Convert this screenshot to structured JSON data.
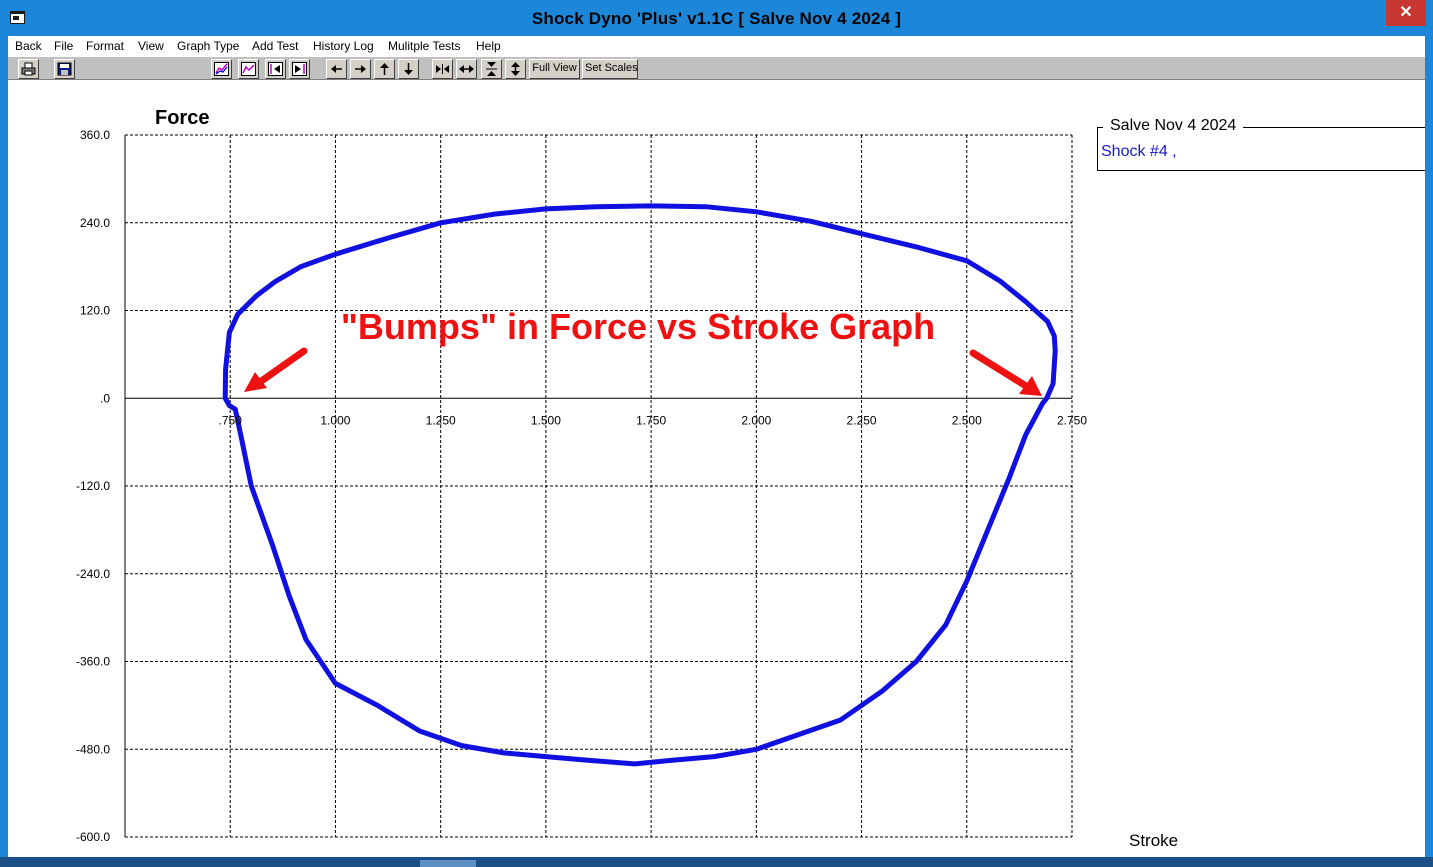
{
  "window": {
    "title": "Shock Dyno 'Plus' v1.1C  [ Salve Nov 4 2024 ]",
    "close_glyph": "✕",
    "app_icon": "app-window-icon"
  },
  "menu": {
    "items": [
      "Back",
      "File",
      "Format",
      "View",
      "Graph Type",
      "Add Test",
      "History Log",
      "Mulitple Tests",
      "Help"
    ]
  },
  "toolbar": {
    "buttons": [
      {
        "icon": "print-icon"
      },
      {
        "icon": "save-icon"
      },
      {
        "icon": "graph-overlay-icon"
      },
      {
        "icon": "graph-icon"
      },
      {
        "icon": "previous-test-icon"
      },
      {
        "icon": "next-test-icon"
      },
      {
        "icon": "arrow-left-icon"
      },
      {
        "icon": "arrow-right-icon"
      },
      {
        "icon": "arrow-up-icon"
      },
      {
        "icon": "arrow-down-icon"
      },
      {
        "icon": "shrink-horizontal-icon"
      },
      {
        "icon": "expand-horizontal-icon"
      },
      {
        "icon": "shrink-vertical-icon"
      },
      {
        "icon": "expand-vertical-icon"
      }
    ],
    "full_view_label": "Full View",
    "set_scales_label": "Set Scales"
  },
  "chart_data": {
    "type": "line",
    "title": "",
    "ylabel": "Force",
    "xlabel": "Stroke",
    "xlim": [
      0.5,
      2.75
    ],
    "ylim": [
      -600,
      360
    ],
    "x_ticks": [
      0.75,
      1.0,
      1.25,
      1.5,
      1.75,
      2.0,
      2.25,
      2.5,
      2.75
    ],
    "x_tick_labels": [
      ".750",
      "1.000",
      "1.250",
      "1.500",
      "1.750",
      "2.000",
      "2.250",
      "2.500",
      "2.750"
    ],
    "y_ticks": [
      360,
      240,
      120,
      0,
      -120,
      -240,
      -360,
      -480,
      -600
    ],
    "y_tick_labels": [
      "360.0",
      "240.0",
      "120.0",
      ".0",
      "-120.0",
      "-240.0",
      "-360.0",
      "-480.0",
      "-600.0"
    ],
    "grid": true,
    "grid_style": "dotted",
    "line_color": "#1010e0",
    "series": [
      {
        "x": [
          0.738,
          0.739,
          0.748,
          0.768,
          0.812,
          0.858,
          0.918,
          1.0,
          1.13,
          1.25,
          1.38,
          1.5,
          1.62,
          1.75,
          1.88,
          2.0,
          2.13,
          2.25,
          2.38,
          2.5,
          2.58,
          2.64,
          2.692,
          2.708,
          2.71,
          2.705,
          2.69,
          2.68,
          2.64,
          2.6,
          2.55,
          2.5,
          2.45,
          2.38,
          2.3,
          2.2,
          2.1,
          2.0,
          1.9,
          1.8,
          1.71,
          1.6,
          1.5,
          1.4,
          1.3,
          1.2,
          1.1,
          1.0,
          0.93,
          0.89,
          0.85,
          0.8,
          0.775,
          0.762,
          0.748,
          0.738
        ],
        "y": [
          0,
          40,
          90,
          115,
          140,
          160,
          180,
          197,
          220,
          240,
          252,
          259,
          262,
          263,
          262,
          255,
          242,
          225,
          207,
          188,
          160,
          132,
          105,
          85,
          65,
          20,
          0,
          -7,
          -50,
          -110,
          -180,
          -250,
          -310,
          -360,
          -400,
          -440,
          -460,
          -480,
          -490,
          -495,
          -500,
          -495,
          -490,
          -485,
          -475,
          -455,
          -420,
          -390,
          -330,
          -270,
          -200,
          -120,
          -50,
          -15,
          -10,
          0
        ]
      }
    ],
    "annotations": [
      {
        "text": "\"Bumps\" in Force vs Stroke Graph",
        "color": "#ee1111"
      }
    ]
  },
  "legend": {
    "title": "Salve Nov 4 2024",
    "entries": [
      "Shock #4 ,"
    ]
  }
}
